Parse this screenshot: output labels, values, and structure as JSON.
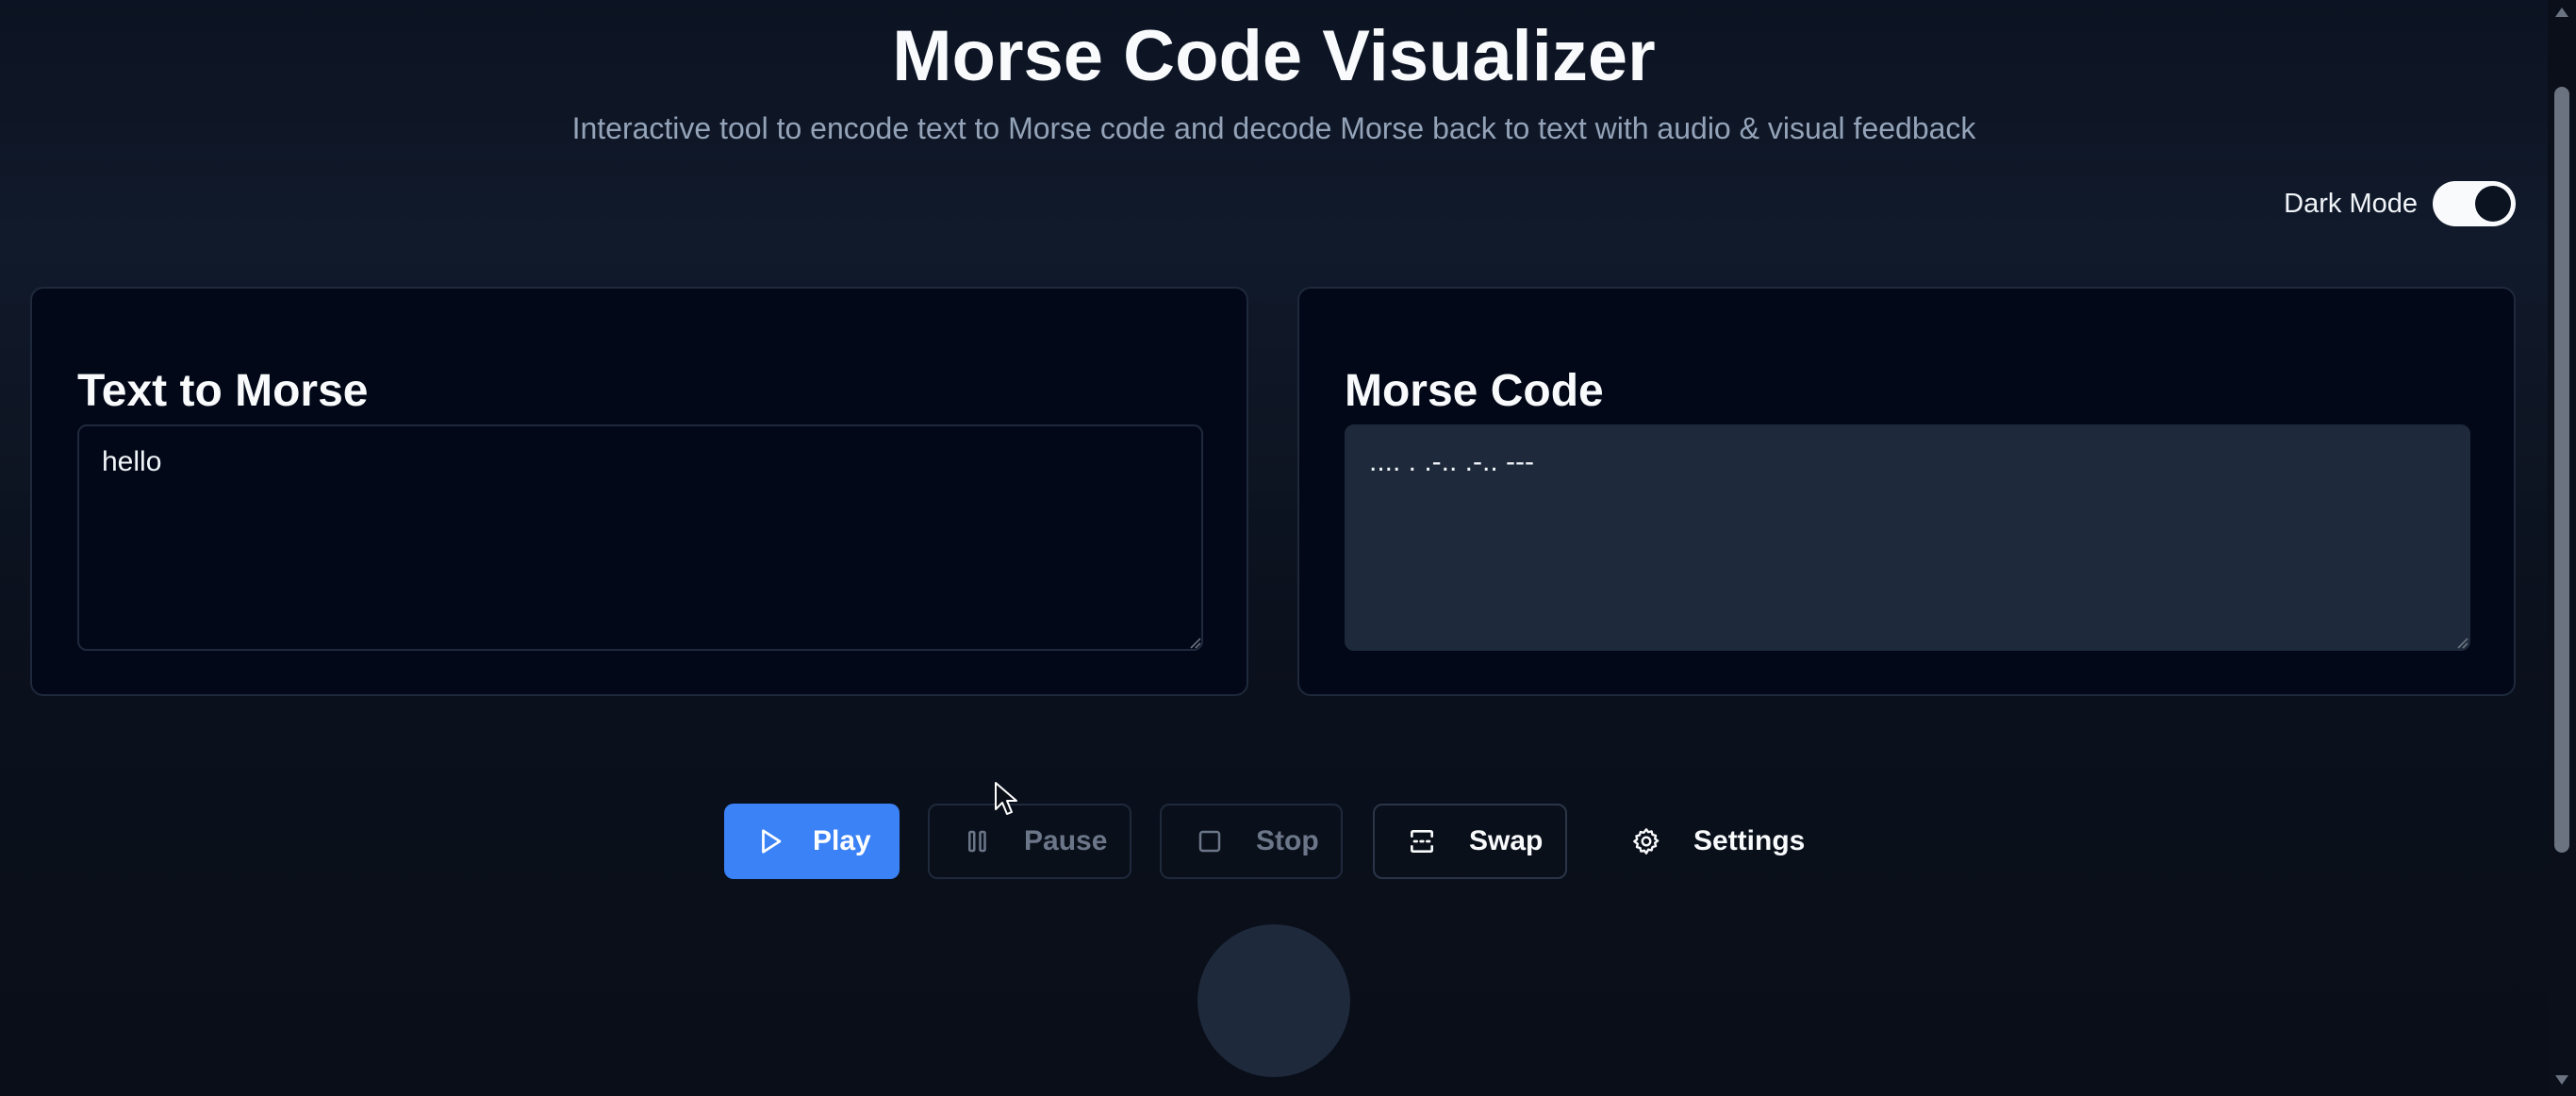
{
  "header": {
    "title": "Morse Code Visualizer",
    "subtitle": "Interactive tool to encode text to Morse code and decode Morse back to text with audio & visual feedback"
  },
  "theme_toggle": {
    "label": "Dark Mode",
    "checked": true
  },
  "encoder": {
    "title": "Text to Morse",
    "value": "hello"
  },
  "decoder": {
    "title": "Morse Code",
    "value": ".... . .-.. .-.. ---"
  },
  "controls": {
    "play_label": "Play",
    "pause_label": "Pause",
    "stop_label": "Stop",
    "swap_label": "Swap",
    "settings_label": "Settings"
  },
  "icons": {
    "play": "play-icon",
    "pause": "pause-icon",
    "stop": "stop-icon",
    "swap": "swap-icon",
    "settings": "gear-icon"
  },
  "colors": {
    "accent": "#3b82f6",
    "background": "#0c1322",
    "panel": "#020817",
    "output_field": "#1e293b",
    "muted_text": "#94a3b8",
    "signal_light_off": "#1e293b"
  }
}
